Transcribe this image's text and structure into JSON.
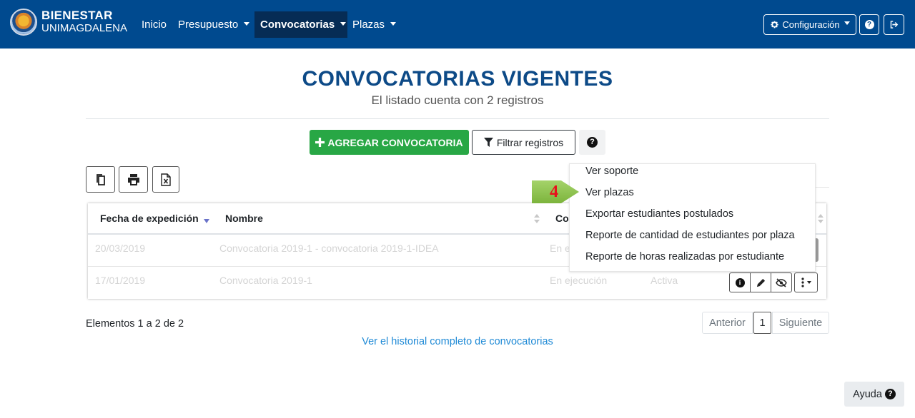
{
  "brand": {
    "line1": "BIENESTAR",
    "line2": "UNIMAGDALENA"
  },
  "nav": {
    "inicio": "Inicio",
    "presupuesto": "Presupuesto",
    "convocatorias": "Convocatorias",
    "plazas": "Plazas",
    "configuracion": "Configuración"
  },
  "header": {
    "title": "CONVOCATORIAS VIGENTES",
    "subtitle": "El listado cuenta con 2 registros"
  },
  "actions": {
    "add": "AGREGAR CONVOCATORIA",
    "filter": "Filtrar registros"
  },
  "table": {
    "columns": [
      "Fecha de expedición",
      "Nombre",
      "Co"
    ],
    "rows": [
      {
        "fecha": "20/03/2019",
        "nombre": "Convocatoria 2019-1 - convocatoria 2019-1-IDEA",
        "estado": "En e"
      },
      {
        "fecha": "17/01/2019",
        "nombre": "Convocatoria 2019-1",
        "estado": "En ejecución",
        "activa": "Activa"
      }
    ]
  },
  "dropdown": {
    "items": [
      "Ver soporte",
      "Ver plazas",
      "Exportar estudiantes postulados",
      "Reporte de cantidad de estudiantes por plaza",
      "Reporte de horas realizadas por estudiante"
    ]
  },
  "callout": {
    "step": "4"
  },
  "footer": {
    "info": "Elementos 1 a 2 de 2",
    "prev": "Anterior",
    "page": "1",
    "next": "Siguiente",
    "history": "Ver el historial completo de convocatorias",
    "help": "Ayuda"
  },
  "icons": {
    "navbar": [
      "gear-icon",
      "question-icon",
      "sign-out-icon"
    ],
    "toolbar": [
      "copy-icon",
      "print-icon",
      "excel-file-icon"
    ],
    "row_actions": [
      "info-icon",
      "pencil-icon",
      "eye-slash-icon",
      "more-vertical-icon"
    ]
  },
  "colors": {
    "navbar": "#004a8f",
    "active_nav": "#062c55",
    "title": "#0d4a87",
    "add_button": "#28a745",
    "link": "#1f8ad6",
    "callout": "#8cc44f",
    "callout_number": "#e8111c"
  }
}
